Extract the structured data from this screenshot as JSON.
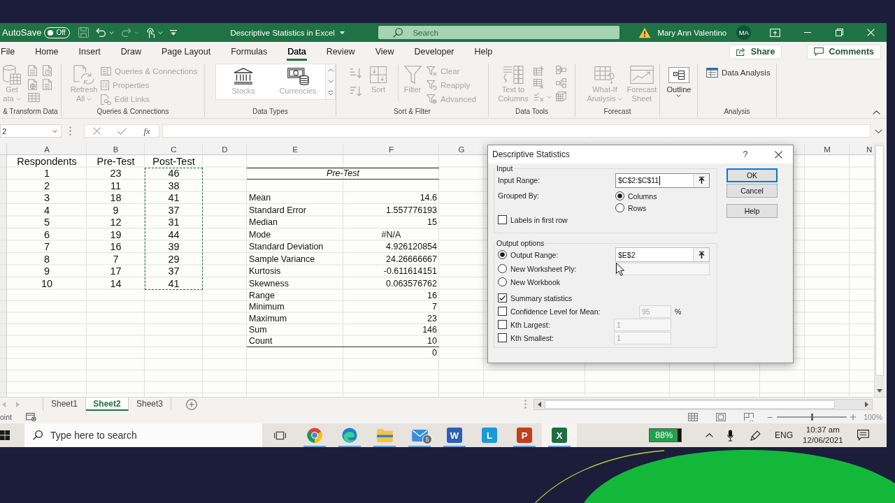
{
  "title_bar": {
    "autosave": {
      "label": "AutoSave",
      "state_text": "Off",
      "on": false
    },
    "quick_access": [
      {
        "disabled": true,
        "menu": false
      },
      {
        "disabled": false,
        "menu": true
      },
      {
        "disabled": true,
        "menu": true
      },
      {
        "disabled": false,
        "menu": true
      },
      {
        "disabled": false,
        "menu": false
      }
    ],
    "document_title": "Descriptive Statistics in Excel",
    "search": {
      "placeholder": "Search"
    },
    "user": {
      "name": "Mary Ann Valentino",
      "initials": "MA"
    }
  },
  "ribbon_tabs": [
    {
      "label": "File",
      "selected": false
    },
    {
      "label": "Home",
      "selected": false
    },
    {
      "label": "Insert",
      "selected": false
    },
    {
      "label": "Draw",
      "selected": false
    },
    {
      "label": "Page Layout",
      "selected": false
    },
    {
      "label": "Formulas",
      "selected": false
    },
    {
      "label": "Data",
      "selected": true
    },
    {
      "label": "Review",
      "selected": false
    },
    {
      "label": "View",
      "selected": false
    },
    {
      "label": "Developer",
      "selected": false
    },
    {
      "label": "Help",
      "selected": false
    }
  ],
  "share": {
    "label": "Share"
  },
  "comments": {
    "label": "Comments"
  },
  "ribbon": {
    "groups": [
      {
        "kind": "get_data",
        "label": "& Transform Data",
        "buttons": [
          {
            "lines": [
              "Get",
              "ata"
            ],
            "menu": true,
            "disabled": true
          }
        ]
      },
      {
        "kind": "queries",
        "label": "Queries & Connections",
        "buttons": [
          {
            "lines": [
              "Refresh",
              "All"
            ],
            "menu": true,
            "disabled": true
          }
        ],
        "commands": [
          {
            "label": "Queries & Connections",
            "disabled": true
          },
          {
            "label": "Properties",
            "disabled": true
          },
          {
            "label": "Edit Links",
            "disabled": true
          }
        ]
      },
      {
        "kind": "gallery",
        "label": "Data Types",
        "buttons": [
          {
            "lines": [
              "Stocks"
            ],
            "menu": false,
            "disabled": true
          },
          {
            "lines": [
              "Currencies"
            ],
            "menu": false,
            "disabled": true
          }
        ]
      },
      {
        "kind": "sort_filter",
        "label": "Sort & Filter",
        "buttons": [
          {
            "lines": [
              "Sort"
            ],
            "menu": false,
            "disabled": true
          },
          {
            "lines": [
              "Filter"
            ],
            "menu": false,
            "disabled": true
          }
        ],
        "commands": [
          {
            "label": "Clear",
            "disabled": true
          },
          {
            "label": "Reapply",
            "disabled": true
          },
          {
            "label": "Advanced",
            "disabled": true
          }
        ]
      },
      {
        "kind": "data_tools",
        "label": "Data Tools",
        "buttons": [
          {
            "lines": [
              "Text to",
              "Columns"
            ],
            "menu": false,
            "disabled": true
          }
        ]
      },
      {
        "kind": "forecast",
        "label": "Forecast",
        "buttons": [
          {
            "lines": [
              "What-If",
              "Analysis"
            ],
            "menu": true,
            "disabled": true
          },
          {
            "lines": [
              "Forecast",
              "Sheet"
            ],
            "menu": false,
            "disabled": true
          }
        ]
      },
      {
        "kind": "outline",
        "buttons": [
          {
            "lines": [
              "Outline"
            ],
            "menu": true,
            "disabled": false
          }
        ]
      },
      {
        "kind": "analysis",
        "label": "Analysis",
        "commands": [
          {
            "label": "Data Analysis",
            "disabled": false
          }
        ]
      }
    ]
  },
  "formula_bar": {
    "name_box": "2",
    "function_label": "fx"
  },
  "sheet": {
    "column_headers": [
      "A",
      "B",
      "C",
      "D",
      "E",
      "F",
      "G"
    ],
    "right_column_headers": [
      "M",
      "N"
    ],
    "data_table": {
      "columns": [
        {
          "header": "Respondents",
          "marquee": false
        },
        {
          "header": "Pre-Test",
          "marquee": false
        },
        {
          "header": "Post-Test",
          "marquee": true
        }
      ],
      "rows": [
        [
          "1",
          "23",
          "46"
        ],
        [
          "2",
          "11",
          "38"
        ],
        [
          "3",
          "18",
          "41"
        ],
        [
          "4",
          "9",
          "37"
        ],
        [
          "5",
          "12",
          "31"
        ],
        [
          "6",
          "19",
          "44"
        ],
        [
          "7",
          "16",
          "39"
        ],
        [
          "8",
          "7",
          "29"
        ],
        [
          "9",
          "17",
          "37"
        ],
        [
          "10",
          "14",
          "41"
        ]
      ]
    },
    "stats_table": {
      "title": "Pre-Test",
      "rows": [
        {
          "label": "Mean",
          "value": "14.6",
          "kind": "number"
        },
        {
          "label": "Standard Error",
          "value": "1.557776193",
          "kind": "number"
        },
        {
          "label": "Median",
          "value": "15",
          "kind": "number"
        },
        {
          "label": "Mode",
          "value": "#N/A",
          "kind": "error"
        },
        {
          "label": "Standard Deviation",
          "value": "4.926120854",
          "kind": "number"
        },
        {
          "label": "Sample Variance",
          "value": "24.26666667",
          "kind": "number"
        },
        {
          "label": "Kurtosis",
          "value": "-0.611614151",
          "kind": "number"
        },
        {
          "label": "Skewness",
          "value": "0.063576762",
          "kind": "number"
        },
        {
          "label": "Range",
          "value": "16",
          "kind": "number"
        },
        {
          "label": "Minimum",
          "value": "7",
          "kind": "number"
        },
        {
          "label": "Maximum",
          "value": "23",
          "kind": "number"
        },
        {
          "label": "Sum",
          "value": "146",
          "kind": "number"
        },
        {
          "label": "Count",
          "value": "10",
          "kind": "number"
        }
      ],
      "trailing_value": "0"
    }
  },
  "sheet_tabs": [
    {
      "label": "Sheet1",
      "selected": false
    },
    {
      "label": "Sheet2",
      "selected": true
    },
    {
      "label": "Sheet3",
      "selected": false
    }
  ],
  "status_bar": {
    "mode": "oint",
    "zoom": {
      "level": 0.5,
      "reading": "100%"
    }
  },
  "dialog": {
    "title": "Descriptive Statistics",
    "help_label": "?",
    "input_group": {
      "label": "Input",
      "range": {
        "label": "Input Range:",
        "value": "$C$2:$C$11",
        "focused": true
      },
      "grouped_by": {
        "label": "Grouped By:",
        "options": [
          {
            "label": "Columns",
            "selected": true
          },
          {
            "label": "Rows",
            "selected": false
          }
        ]
      },
      "labels_in_first_row": {
        "label": "Labels in first row",
        "checked": false
      }
    },
    "output_group": {
      "label": "Output options",
      "destinations": [
        {
          "label": "Output Range:",
          "selected": true,
          "kind": "range",
          "value": "$E$2"
        },
        {
          "label": "New Worksheet Ply:",
          "selected": false,
          "kind": "text"
        },
        {
          "label": "New Workbook",
          "selected": false,
          "kind": "none"
        }
      ],
      "options": [
        {
          "label": "Summary statistics",
          "checked": true,
          "kind": "plain"
        },
        {
          "label": "Confidence Level for Mean:",
          "checked": false,
          "kind": "percent",
          "value": "95",
          "unit": "%"
        },
        {
          "label": "Kth Largest:",
          "checked": false,
          "kind": "number",
          "value": "1"
        },
        {
          "label": "Kth Smallest:",
          "checked": false,
          "kind": "number",
          "value": "1"
        }
      ]
    },
    "buttons": [
      {
        "label": "OK",
        "default": true
      },
      {
        "label": "Cancel",
        "default": false
      },
      {
        "label": "Help",
        "default": false
      }
    ]
  },
  "taskbar": {
    "search_placeholder": "Type here to search",
    "apps": [
      {
        "kind": "round_logo",
        "running": true,
        "selected": false
      },
      {
        "kind": "wave_logo",
        "running": true,
        "selected": false
      },
      {
        "kind": "folder",
        "running": true,
        "selected": false
      },
      {
        "kind": "envelope",
        "badge": "5",
        "running": true,
        "selected": false
      },
      {
        "kind": "letter_tile",
        "glyph": "W",
        "color": "#2b5fb4",
        "running": true,
        "selected": false
      },
      {
        "kind": "letter_tile",
        "glyph": "L",
        "color": "#1a9ad6",
        "running": false,
        "selected": false
      },
      {
        "kind": "letter_tile",
        "glyph": "P",
        "color": "#c43e1c",
        "running": true,
        "selected": false
      },
      {
        "kind": "letter_tile",
        "glyph": "X",
        "color": "#1d6f42",
        "running": true,
        "selected": true
      }
    ],
    "battery": {
      "level": 0.88,
      "reading": "88%"
    },
    "language": "ENG",
    "time": "10:37 am",
    "date": "12/06/2021"
  }
}
